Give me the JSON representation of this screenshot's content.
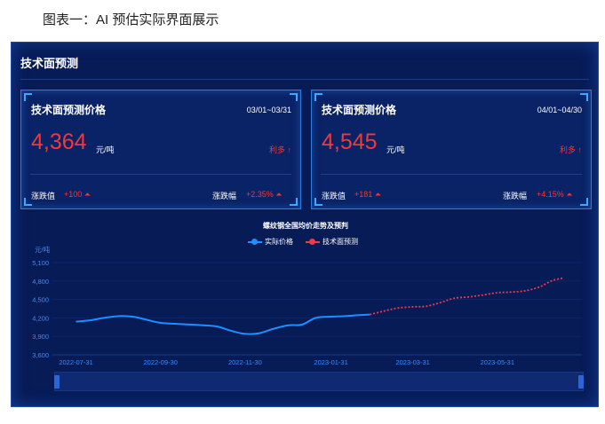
{
  "caption": "图表一：AI 预估实际界面展示",
  "panel": {
    "title": "技术面预测"
  },
  "cards": [
    {
      "title": "技术面预测价格",
      "date_range": "03/01~03/31",
      "price": "4,364",
      "unit": "元/吨",
      "signal": "利多 ↑",
      "change_label": "涨跌值",
      "change_value": "+100 ⏶",
      "pct_label": "涨跌幅",
      "pct_value": "+2.35% ⏶"
    },
    {
      "title": "技术面预测价格",
      "date_range": "04/01~04/30",
      "price": "4,545",
      "unit": "元/吨",
      "signal": "利多 ↑",
      "change_label": "涨跌值",
      "change_value": "+181 ⏶",
      "pct_label": "涨跌幅",
      "pct_value": "+4.15% ⏶"
    }
  ],
  "colors": {
    "actual": "#1e8fff",
    "forecast": "#f03a4a",
    "up": "#f03a3a",
    "axis_text": "#3d8cff"
  },
  "chart_data": {
    "type": "line",
    "title": "螺纹钢全国均价走势及预判",
    "ylabel": "元/吨",
    "ylim": [
      3600,
      5100
    ],
    "yticks": [
      "5,100",
      "4,800",
      "4,500",
      "4,200",
      "3,900",
      "3,600"
    ],
    "xticks": [
      "2022-07-31",
      "2022-09-30",
      "2022-11-30",
      "2023-01-31",
      "2023-03-31",
      "2023-05-31"
    ],
    "xrange": [
      "2022-07-14",
      "2023-07-31"
    ],
    "legend": [
      "实际价格",
      "技术面预测"
    ],
    "series": [
      {
        "name": "实际价格",
        "x": [
          "2022-07-31",
          "2022-08-10",
          "2022-08-20",
          "2022-08-31",
          "2022-09-10",
          "2022-09-20",
          "2022-09-30",
          "2022-10-15",
          "2022-10-31",
          "2022-11-10",
          "2022-11-20",
          "2022-11-30",
          "2022-12-10",
          "2022-12-20",
          "2022-12-31",
          "2023-01-10",
          "2023-01-20",
          "2023-01-31",
          "2023-02-10",
          "2023-02-20",
          "2023-02-28"
        ],
        "values": [
          4140,
          4160,
          4200,
          4230,
          4220,
          4170,
          4120,
          4100,
          4080,
          4060,
          3990,
          3940,
          3950,
          4020,
          4080,
          4090,
          4200,
          4220,
          4230,
          4245,
          4255
        ]
      },
      {
        "name": "技术面预测",
        "x": [
          "2023-02-28",
          "2023-03-10",
          "2023-03-20",
          "2023-03-31",
          "2023-04-10",
          "2023-04-20",
          "2023-04-30",
          "2023-05-10",
          "2023-05-20",
          "2023-05-31",
          "2023-06-10",
          "2023-06-20",
          "2023-06-30",
          "2023-07-10",
          "2023-07-18"
        ],
        "values": [
          4255,
          4310,
          4360,
          4380,
          4390,
          4450,
          4520,
          4540,
          4570,
          4610,
          4620,
          4640,
          4700,
          4810,
          4850
        ]
      }
    ]
  }
}
